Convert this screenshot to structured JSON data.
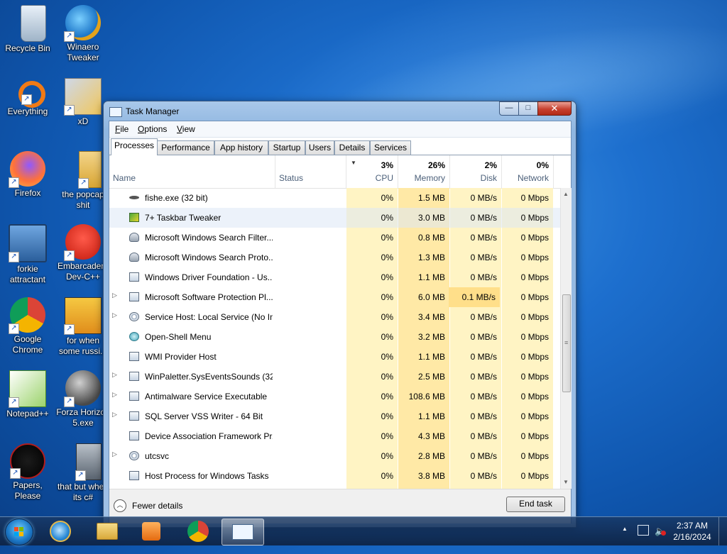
{
  "desktop": {
    "icons": [
      {
        "label": "Recycle Bin",
        "icon": "recycle-bin-icon"
      },
      {
        "label": "Winaero Tweaker",
        "icon": "winaero-tweaker-icon"
      },
      {
        "label": "Everything",
        "icon": "everything-search-icon"
      },
      {
        "label": "xD",
        "icon": "hxd-hex-editor-icon"
      },
      {
        "label": "Firefox",
        "icon": "firefox-icon"
      },
      {
        "label": "the popcap shit",
        "icon": "folder-icon"
      },
      {
        "label": "forkie attractant",
        "icon": "computer-settings-icon"
      },
      {
        "label": "Embarcadero Dev-C++",
        "icon": "dev-cpp-icon"
      },
      {
        "label": "Google Chrome",
        "icon": "chrome-icon"
      },
      {
        "label": "for when some russi...",
        "icon": "de-app-icon"
      },
      {
        "label": "Notepad++",
        "icon": "notepadpp-icon"
      },
      {
        "label": "Forza Horizon 5.exe",
        "icon": "flash-icon"
      },
      {
        "label": "Papers, Please",
        "icon": "papers-please-icon"
      },
      {
        "label": "that but when its c#",
        "icon": "window-stack-icon"
      }
    ]
  },
  "window": {
    "title": "Task Manager",
    "controls": {
      "minimize": "—",
      "maximize": "□",
      "close": "✕"
    }
  },
  "menu": {
    "file": "File",
    "options": "Options",
    "view": "View"
  },
  "tabs": [
    "Processes",
    "Performance",
    "App history",
    "Startup",
    "Users",
    "Details",
    "Services"
  ],
  "columns": {
    "name": "Name",
    "status": "Status",
    "cpu": {
      "label": "CPU",
      "total": "3%"
    },
    "memory": {
      "label": "Memory",
      "total": "26%"
    },
    "disk": {
      "label": "Disk",
      "total": "2%"
    },
    "network": {
      "label": "Network",
      "total": "0%"
    }
  },
  "processes": [
    {
      "name": "fishe.exe (32 bit)",
      "cpu": "0%",
      "memory": "1.5 MB",
      "disk": "0 MB/s",
      "network": "0 Mbps",
      "icon": "fish-icon",
      "expandable": false
    },
    {
      "name": "7+ Taskbar Tweaker",
      "cpu": "0%",
      "memory": "3.0 MB",
      "disk": "0 MB/s",
      "network": "0 Mbps",
      "icon": "tweaker-icon",
      "expandable": false
    },
    {
      "name": "Microsoft Windows Search Filter...",
      "cpu": "0%",
      "memory": "0.8 MB",
      "disk": "0 MB/s",
      "network": "0 Mbps",
      "icon": "user-icon",
      "expandable": false
    },
    {
      "name": "Microsoft Windows Search Proto...",
      "cpu": "0%",
      "memory": "1.3 MB",
      "disk": "0 MB/s",
      "network": "0 Mbps",
      "icon": "user-icon",
      "expandable": false
    },
    {
      "name": "Windows Driver Foundation - Us...",
      "cpu": "0%",
      "memory": "1.1 MB",
      "disk": "0 MB/s",
      "network": "0 Mbps",
      "icon": "window-icon",
      "expandable": false
    },
    {
      "name": "Microsoft Software Protection Pl...",
      "cpu": "0%",
      "memory": "6.0 MB",
      "disk": "0.1 MB/s",
      "network": "0 Mbps",
      "icon": "window-icon",
      "expandable": true
    },
    {
      "name": "Service Host: Local Service (No Im...",
      "cpu": "0%",
      "memory": "3.4 MB",
      "disk": "0 MB/s",
      "network": "0 Mbps",
      "icon": "gear-icon",
      "expandable": true
    },
    {
      "name": "Open-Shell Menu",
      "cpu": "0%",
      "memory": "3.2 MB",
      "disk": "0 MB/s",
      "network": "0 Mbps",
      "icon": "shell-icon",
      "expandable": false
    },
    {
      "name": "WMI Provider Host",
      "cpu": "0%",
      "memory": "1.1 MB",
      "disk": "0 MB/s",
      "network": "0 Mbps",
      "icon": "window-icon",
      "expandable": false
    },
    {
      "name": "WinPaletter.SysEventsSounds (32...",
      "cpu": "0%",
      "memory": "2.5 MB",
      "disk": "0 MB/s",
      "network": "0 Mbps",
      "icon": "window-icon",
      "expandable": true
    },
    {
      "name": "Antimalware Service Executable",
      "cpu": "0%",
      "memory": "108.6 MB",
      "disk": "0 MB/s",
      "network": "0 Mbps",
      "icon": "window-icon",
      "expandable": true
    },
    {
      "name": "SQL Server VSS Writer - 64 Bit",
      "cpu": "0%",
      "memory": "1.1 MB",
      "disk": "0 MB/s",
      "network": "0 Mbps",
      "icon": "window-icon",
      "expandable": true
    },
    {
      "name": "Device Association Framework Pr...",
      "cpu": "0%",
      "memory": "4.3 MB",
      "disk": "0 MB/s",
      "network": "0 Mbps",
      "icon": "window-icon",
      "expandable": false
    },
    {
      "name": "utcsvc",
      "cpu": "0%",
      "memory": "2.8 MB",
      "disk": "0 MB/s",
      "network": "0 Mbps",
      "icon": "gear-icon",
      "expandable": true
    },
    {
      "name": "Host Process for Windows Tasks",
      "cpu": "0%",
      "memory": "3.8 MB",
      "disk": "0 MB/s",
      "network": "0 Mbps",
      "icon": "window-icon",
      "expandable": false
    }
  ],
  "footer": {
    "fewer_details": "Fewer details",
    "end_task": "End task"
  },
  "taskbar": {
    "items": [
      "start-orb-icon",
      "internet-explorer-icon",
      "file-explorer-icon",
      "media-player-icon",
      "chrome-icon",
      "task-manager-icon"
    ],
    "time": "2:37 AM",
    "date": "2/16/2024"
  },
  "colors": {
    "accent": "#1d6fce",
    "heat_low": "#fff4c4",
    "heat_mid": "#ffe9a6"
  }
}
